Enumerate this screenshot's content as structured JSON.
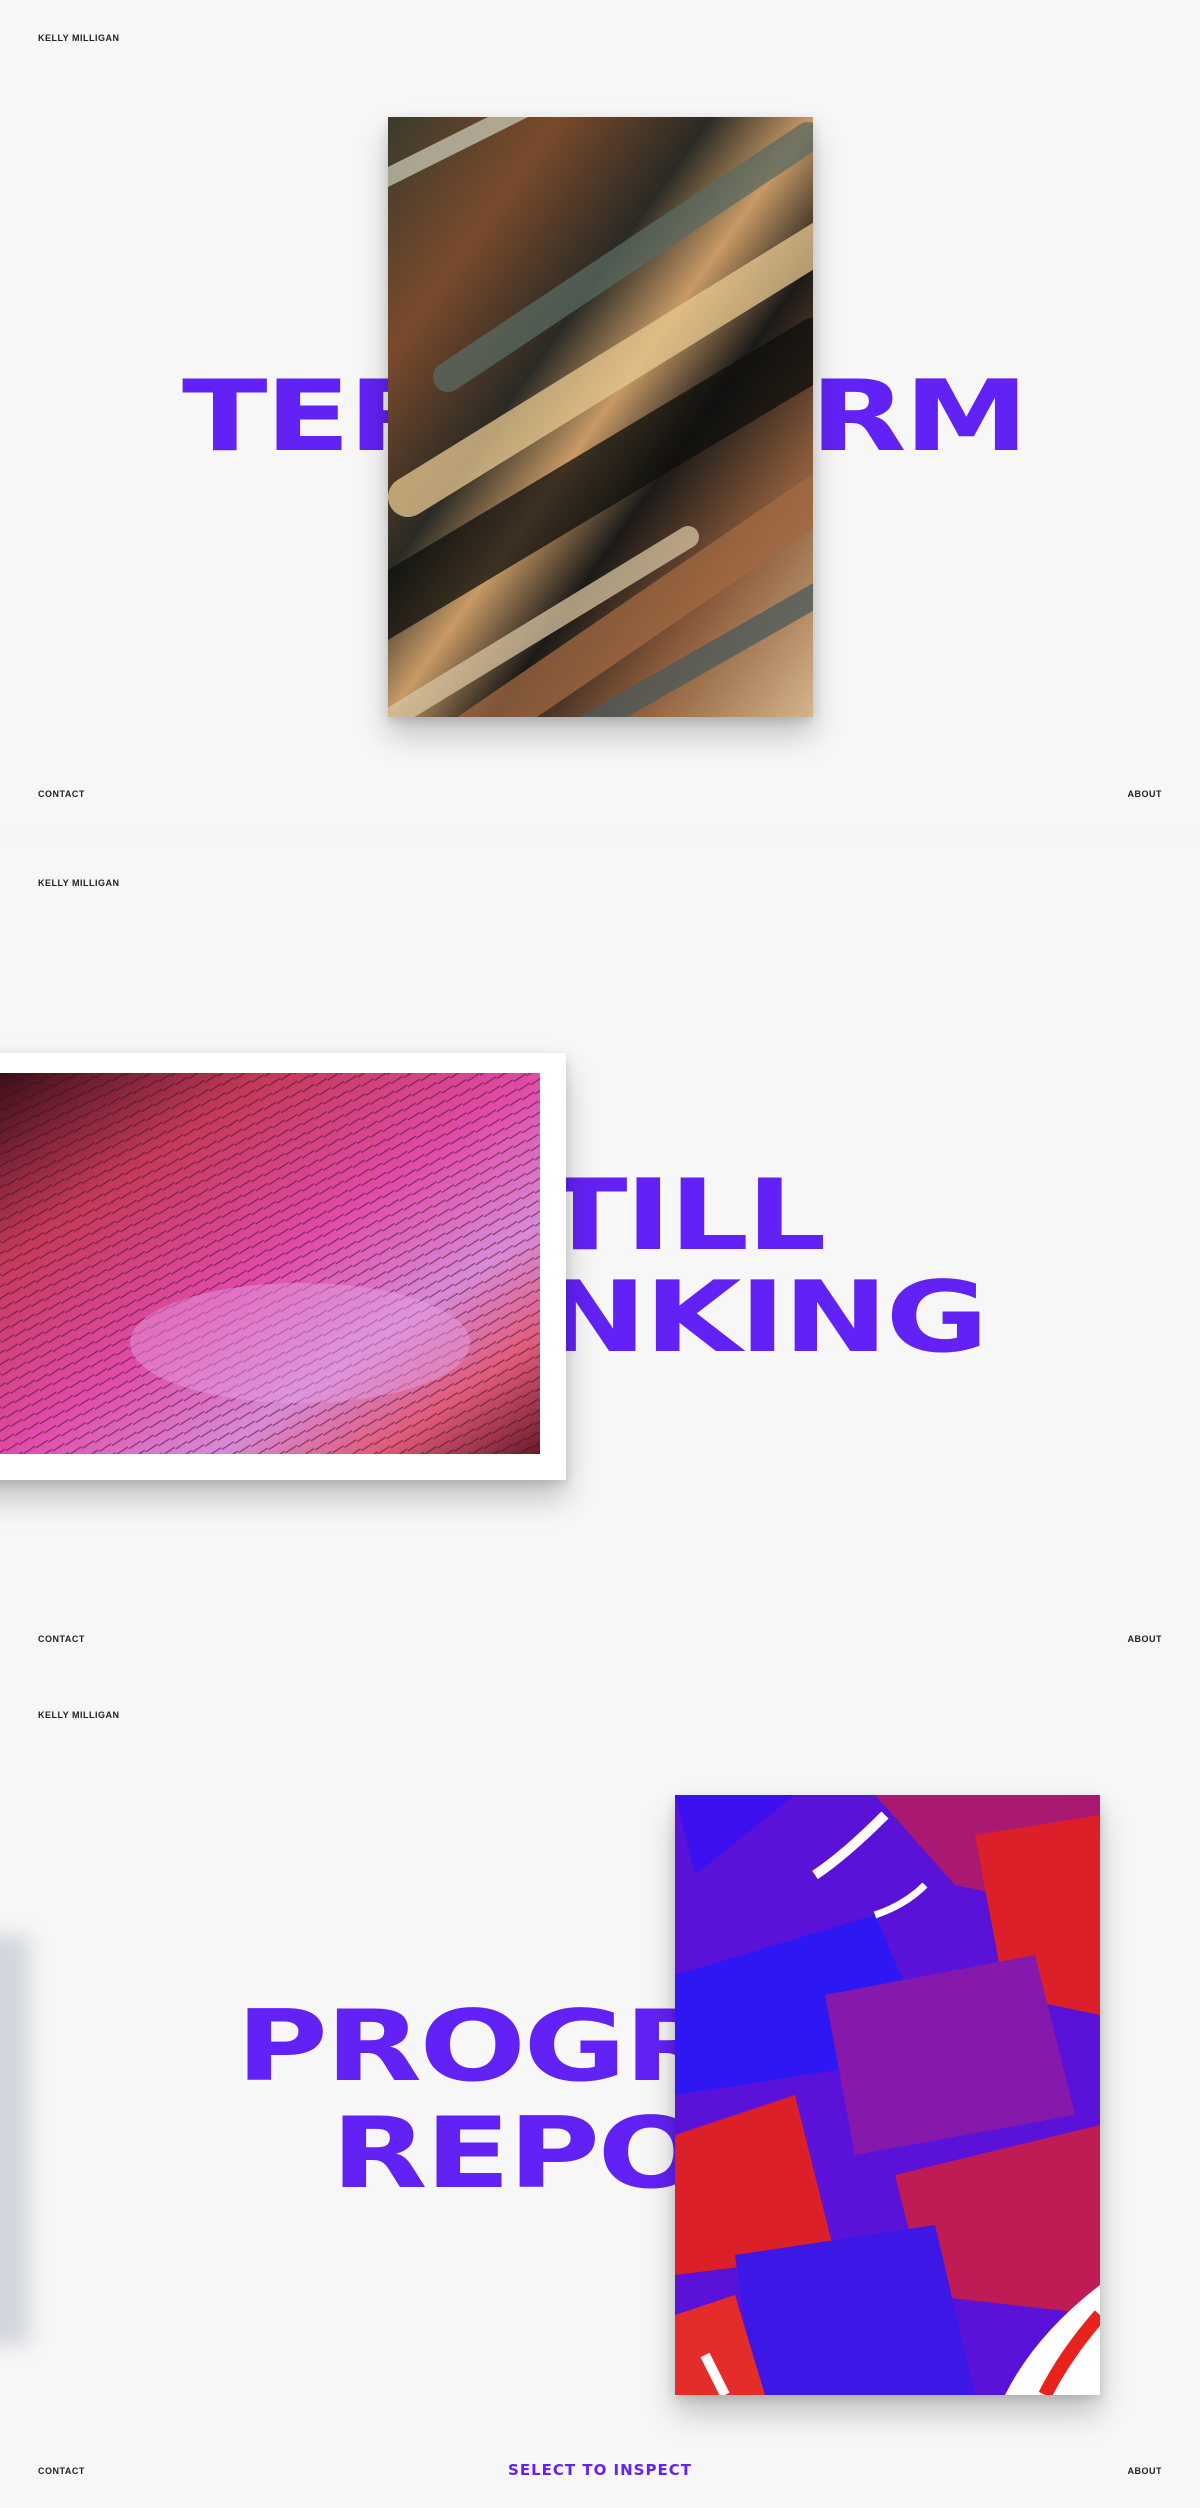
{
  "brand": "KELLY MILLIGAN",
  "nav": {
    "contact": "CONTACT",
    "about": "ABOUT"
  },
  "slides": [
    {
      "title_left": "TER",
      "title_right": "RM",
      "artwork": "brown-brushstroke-painting"
    },
    {
      "line1": "TILL",
      "line2": "NKING",
      "artwork": "pink-fur-texture-painting"
    },
    {
      "line1": "PROGR",
      "line2": "REPO",
      "artwork": "blue-red-abstract-painting"
    }
  ],
  "cta": "SELECT TO INSPECT",
  "colors": {
    "accent": "#6222f5",
    "background": "#f7f7f7",
    "text": "#222222"
  }
}
